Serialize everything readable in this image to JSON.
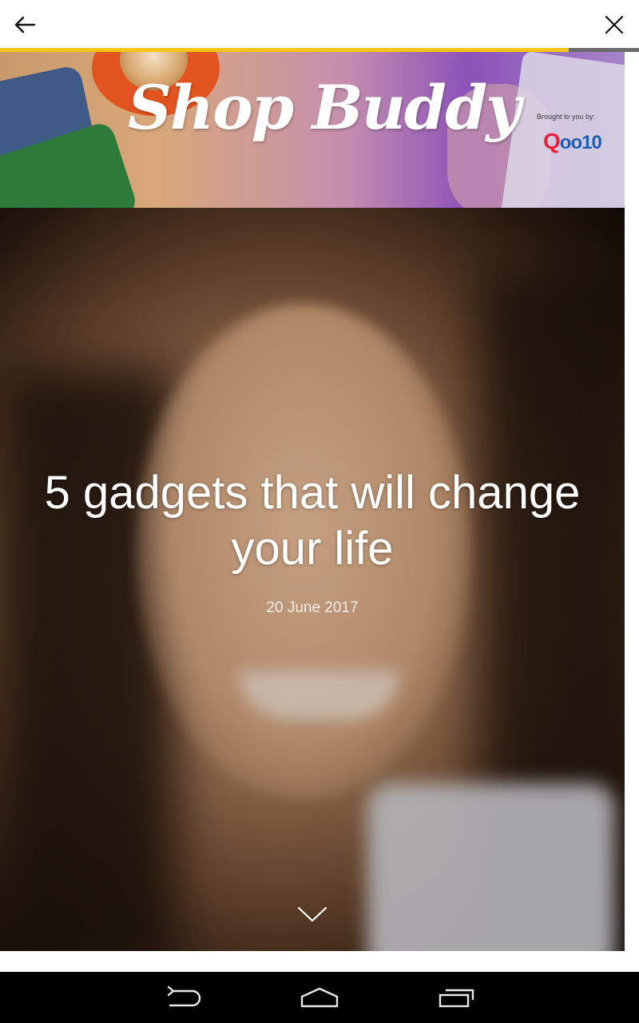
{
  "progress": {
    "fraction": 0.89,
    "fill_color": "#f5c518"
  },
  "toolbar": {
    "back_icon": "arrow-left-icon",
    "close_icon": "close-icon"
  },
  "banner": {
    "brand": "Shop Buddy",
    "sponsor_label": "Brought to you by:",
    "sponsor_logo": "Qoo10"
  },
  "article": {
    "title": "5 gadgets that will change your life",
    "date": "20 June 2017",
    "scroll_icon": "chevron-down-icon"
  },
  "navigation": {
    "back_icon": "back-icon",
    "home_icon": "home-icon",
    "recents_icon": "recent-apps-icon"
  }
}
